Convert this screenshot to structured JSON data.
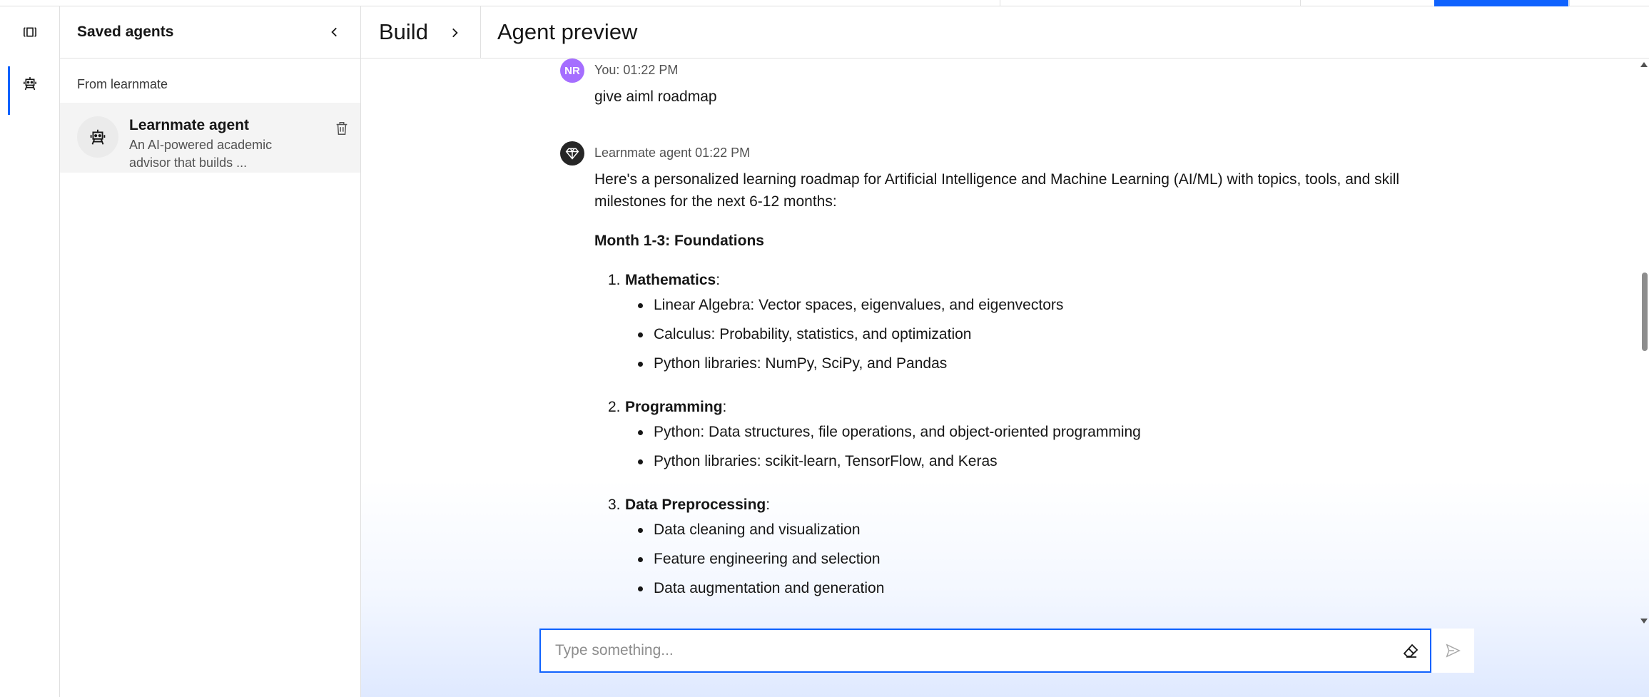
{
  "sidebar": {
    "title": "Saved agents",
    "section_label": "From learnmate",
    "agent": {
      "name": "Learnmate agent",
      "description": "An AI-powered academic advisor that builds ..."
    }
  },
  "header": {
    "build_label": "Build",
    "preview_title": "Agent preview"
  },
  "chat": {
    "user_message": {
      "avatar_initials": "NR",
      "meta": "You: 01:22 PM",
      "text": "give aiml roadmap"
    },
    "agent_message": {
      "meta": "Learnmate agent 01:22 PM",
      "intro": "Here's a personalized learning roadmap for Artificial Intelligence and Machine Learning (AI/ML) with topics, tools, and skill milestones for the next 6-12 months:",
      "section_heading": "Month 1-3: Foundations",
      "items": [
        {
          "number": "1.",
          "title": "Mathematics",
          "bullets": [
            "Linear Algebra: Vector spaces, eigenvalues, and eigenvectors",
            "Calculus: Probability, statistics, and optimization",
            "Python libraries: NumPy, SciPy, and Pandas"
          ]
        },
        {
          "number": "2.",
          "title": "Programming",
          "bullets": [
            "Python: Data structures, file operations, and object-oriented programming",
            "Python libraries: scikit-learn, TensorFlow, and Keras"
          ]
        },
        {
          "number": "3.",
          "title": "Data Preprocessing",
          "bullets": [
            "Data cleaning and visualization",
            "Feature engineering and selection",
            "Data augmentation and generation"
          ]
        }
      ]
    }
  },
  "composer": {
    "placeholder": "Type something..."
  },
  "colors": {
    "accent": "#0f62fe",
    "user_avatar": "#a56eff",
    "bot_avatar": "#262626"
  }
}
